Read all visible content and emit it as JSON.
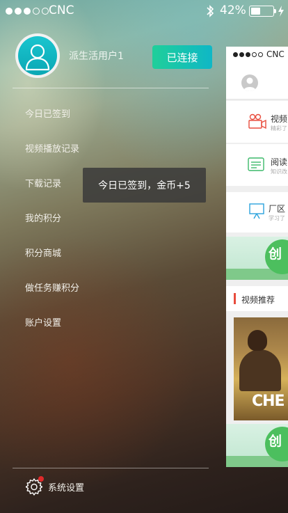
{
  "status_bar": {
    "carrier": "CNC",
    "battery_percent": "42%",
    "battery_level": 0.42,
    "signal_bars": 3,
    "icons": [
      "bluetooth-icon",
      "battery-icon",
      "charging-icon"
    ]
  },
  "profile": {
    "username": "派生活用户1",
    "connect_label": "已连接"
  },
  "menu": {
    "items": [
      {
        "label": "今日已签到"
      },
      {
        "label": "视频播放记录"
      },
      {
        "label": "下载记录"
      },
      {
        "label": "我的积分"
      },
      {
        "label": "积分商城"
      },
      {
        "label": "做任务赚积分"
      },
      {
        "label": "账户设置"
      }
    ]
  },
  "toast": {
    "message": "今日已签到，金币+5"
  },
  "footer": {
    "settings_label": "系统设置"
  },
  "panel": {
    "carrier": "CNC",
    "rows": [
      {
        "title": "视频",
        "subtitle": "精彩了"
      },
      {
        "title": "阅读",
        "subtitle": "知识改"
      },
      {
        "title": "厂区",
        "subtitle": "学习了"
      }
    ],
    "banner_text": "创",
    "section_title": "视频推荐",
    "poster_title": "CHE"
  },
  "colors": {
    "accent_green": "#1fcf9a",
    "accent_cyan": "#0fb7c6",
    "notification_red": "#e02a2a",
    "section_marker": "#e84c3d"
  }
}
